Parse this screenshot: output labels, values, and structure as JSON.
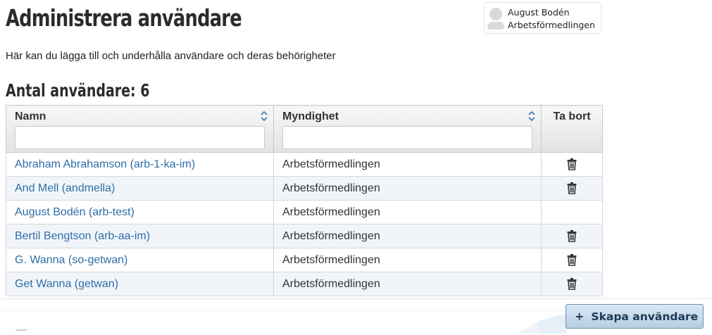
{
  "header": {
    "title": "Administrera användare",
    "user": {
      "name": "August Bodén",
      "organization": "Arbetsförmedlingen"
    }
  },
  "intro_text": "Här kan du lägga till och underhålla användare och deras behörigheter",
  "count_title": "Antal användare: 6",
  "table": {
    "columns": {
      "name": "Namn",
      "agency": "Myndighet",
      "delete": "Ta bort"
    },
    "filters": {
      "name": "",
      "agency": ""
    },
    "rows": [
      {
        "name": "Abraham Abrahamson (arb-1-ka-im)",
        "agency": "Arbetsförmedlingen",
        "deletable": true
      },
      {
        "name": "And Mell (andmella)",
        "agency": "Arbetsförmedlingen",
        "deletable": true
      },
      {
        "name": "August Bodén (arb-test)",
        "agency": "Arbetsförmedlingen",
        "deletable": false
      },
      {
        "name": "Bertil Bengtson (arb-aa-im)",
        "agency": "Arbetsförmedlingen",
        "deletable": true
      },
      {
        "name": "G. Wanna (so-getwan)",
        "agency": "Arbetsförmedlingen",
        "deletable": true
      },
      {
        "name": "Get Wanna (getwan)",
        "agency": "Arbetsförmedlingen",
        "deletable": true
      }
    ]
  },
  "actions": {
    "create_label": "Skapa användare",
    "create_icon": "plus-icon"
  },
  "icons": {
    "sort": "sort-icon",
    "delete": "trash-icon",
    "avatar": "avatar-icon"
  },
  "colors": {
    "link": "#2f6ea7",
    "button_bg": "#c6d9ec",
    "row_alt": "#f1f5fa"
  }
}
